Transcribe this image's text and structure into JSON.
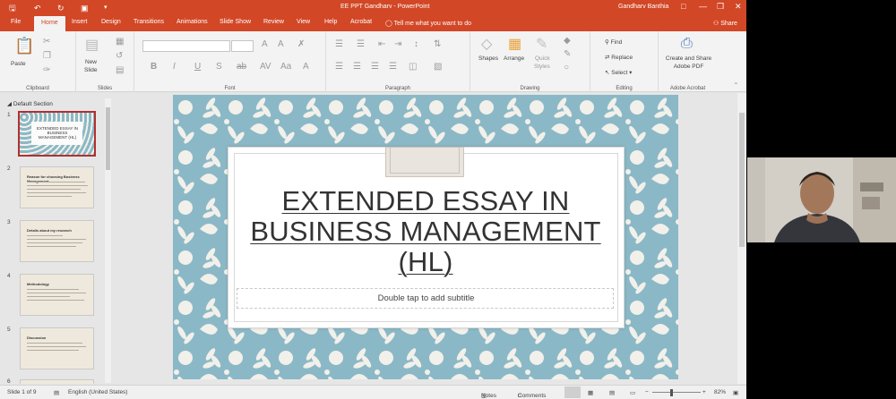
{
  "titlebar": {
    "title": "EE PPT Gandharv  -  PowerPoint",
    "user": "Gandharv Banthia",
    "qa_icons": [
      "save-icon",
      "undo-icon",
      "redo-icon",
      "presenter-icon",
      "customize-icon"
    ],
    "window_icons": [
      "ribbon-display-icon",
      "minimize-icon",
      "restore-icon",
      "close-icon"
    ]
  },
  "tabs": {
    "file": "File",
    "home": "Home",
    "insert": "Insert",
    "design": "Design",
    "transitions": "Transitions",
    "animations": "Animations",
    "slideshow": "Slide Show",
    "review": "Review",
    "view": "View",
    "help": "Help",
    "acrobat": "Acrobat",
    "tellme": "Tell me what you want to do",
    "share": "Share"
  },
  "ribbon": {
    "clipboard": {
      "label": "Clipboard",
      "paste": "Paste"
    },
    "slides": {
      "label": "Slides",
      "new_slide": "New",
      "new_slide2": "Slide"
    },
    "font": {
      "label": "Font"
    },
    "paragraph": {
      "label": "Paragraph"
    },
    "drawing": {
      "label": "Drawing",
      "shapes": "Shapes",
      "arrange": "Arrange",
      "quick_styles": "Quick",
      "quick_styles2": "Styles"
    },
    "editing": {
      "label": "Editing",
      "find": "Find",
      "replace": "Replace",
      "select": "Select"
    },
    "acrobat": {
      "label": "Adobe Acrobat",
      "create_share": "Create and Share",
      "create_share2": "Adobe PDF"
    }
  },
  "panel": {
    "section": "Default Section",
    "slides": [
      {
        "num": "1",
        "title": "EXTENDED ESSAY IN BUSINESS MANAGEMENT (HL)"
      },
      {
        "num": "2",
        "title": "Reason for choosing Business Management"
      },
      {
        "num": "3",
        "title": "Details about my research"
      },
      {
        "num": "4",
        "title": "Methodology"
      },
      {
        "num": "5",
        "title": "Discussion"
      },
      {
        "num": "6",
        "title": ""
      }
    ]
  },
  "slide": {
    "title": "EXTENDED ESSAY IN BUSINESS MANAGEMENT (HL)",
    "subtitle_placeholder": "Double tap to add subtitle",
    "background_color": "#8bb8c6",
    "pattern_color": "#f2f0ea"
  },
  "status": {
    "slide_counter": "Slide 1 of 9",
    "language": "English (United States)",
    "notes": "Notes",
    "comments": "Comments",
    "zoom": "82%"
  },
  "colors": {
    "accent": "#d24726",
    "ribbon": "#f3f3f3"
  }
}
